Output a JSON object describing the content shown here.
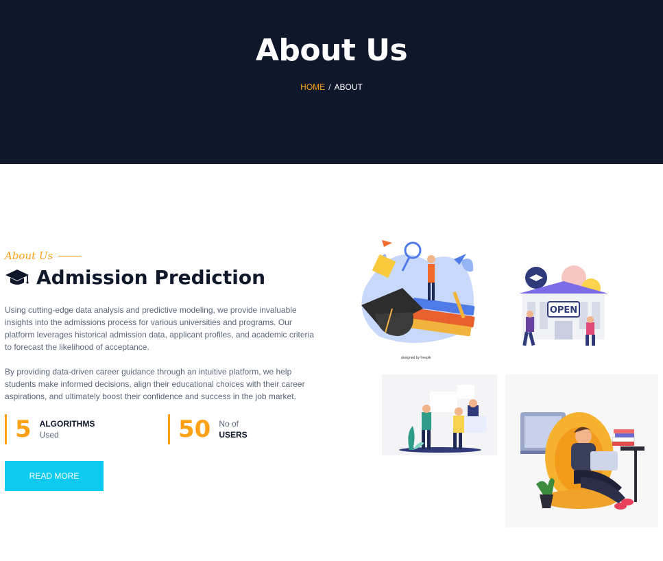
{
  "hero": {
    "title": "About Us",
    "breadcrumb": {
      "home": "HOME",
      "separator": "/",
      "current": "ABOUT"
    }
  },
  "about": {
    "eyebrow": "About Us",
    "title": "Admission Prediction",
    "icon": "graduation-cap-icon",
    "paragraphs": [
      "Using cutting-edge data analysis and predictive modeling, we provide invaluable insights into the admissions process for various universities and programs. Our platform leverages historical admission data, applicant profiles, and academic criteria to forecast the likelihood of acceptance.",
      "By providing data-driven career guidance through an intuitive platform, we help students make informed decisions, align their educational choices with their career aspirations, and ultimately boost their confidence and success in the job market."
    ],
    "stats": [
      {
        "value": "5",
        "label_bold": "ALGORITHMS",
        "label_sub": "Used"
      },
      {
        "value": "50",
        "label_top": "No of",
        "label_bold": "USERS"
      }
    ],
    "button_label": "READ MORE"
  },
  "images": {
    "img1_credit": "designed by freepik",
    "img2_sign": "OPEN"
  },
  "colors": {
    "dark": "#0f172b",
    "accent": "#fea116",
    "button": "#0dcaf0"
  }
}
